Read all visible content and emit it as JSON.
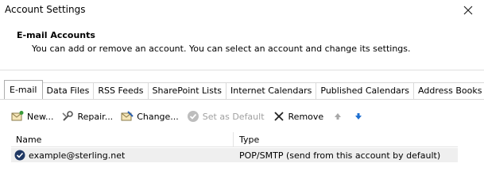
{
  "window": {
    "title": "Account Settings",
    "close_label": "X"
  },
  "header": {
    "title": "E-mail Accounts",
    "description": "You can add or remove an account. You can select an account and change its settings."
  },
  "tabs": [
    {
      "label": "E-mail",
      "active": true
    },
    {
      "label": "Data Files"
    },
    {
      "label": "RSS Feeds"
    },
    {
      "label": "SharePoint Lists"
    },
    {
      "label": "Internet Calendars"
    },
    {
      "label": "Published Calendars"
    },
    {
      "label": "Address Books"
    }
  ],
  "toolbar": {
    "new_label": "New...",
    "repair_label": "Repair...",
    "change_label": "Change...",
    "set_default_label": "Set as Default",
    "remove_label": "Remove"
  },
  "table": {
    "columns": [
      "Name",
      "Type"
    ],
    "rows": [
      {
        "name": "example@sterling.net",
        "type": "POP/SMTP (send from this account by default)",
        "default": true
      }
    ]
  },
  "colors": {
    "accent": "#1e6fd0",
    "selected_row": "#efefef",
    "disabled": "#a0a0a0"
  }
}
